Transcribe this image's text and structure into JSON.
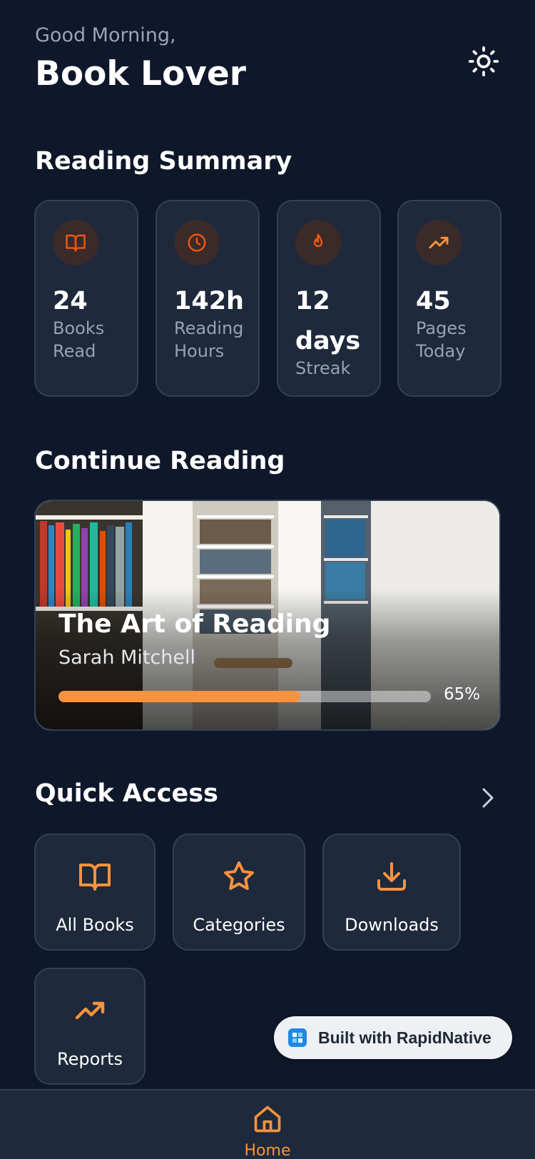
{
  "header": {
    "greeting": "Good Morning,",
    "username": "Book Lover",
    "theme_icon": "sun-icon"
  },
  "summary": {
    "title": "Reading Summary",
    "stats": [
      {
        "icon": "book-open-icon",
        "value": "24",
        "label": "Books Read"
      },
      {
        "icon": "clock-icon",
        "value": "142h",
        "label": "Reading Hours"
      },
      {
        "icon": "flame-icon",
        "value": "12 days",
        "label": "Streak"
      },
      {
        "icon": "trending-up-icon",
        "value": "45",
        "label": "Pages Today"
      }
    ]
  },
  "continue_reading": {
    "title": "Continue Reading",
    "book_title": "The Art of Reading",
    "author": "Sarah Mitchell",
    "progress": 0.65,
    "progress_label": "65%"
  },
  "quick_access": {
    "title": "Quick Access",
    "items": [
      {
        "icon": "book-open-icon",
        "label": "All Books"
      },
      {
        "icon": "star-icon",
        "label": "Categories"
      },
      {
        "icon": "download-icon",
        "label": "Downloads"
      },
      {
        "icon": "trending-up-icon",
        "label": "Reports"
      }
    ]
  },
  "badge": {
    "text": "Built with RapidNative"
  },
  "bottom_nav": {
    "home_label": "Home"
  },
  "colors": {
    "background": "#0f172a",
    "card": "#1e293b",
    "accent": "#fb923c"
  }
}
